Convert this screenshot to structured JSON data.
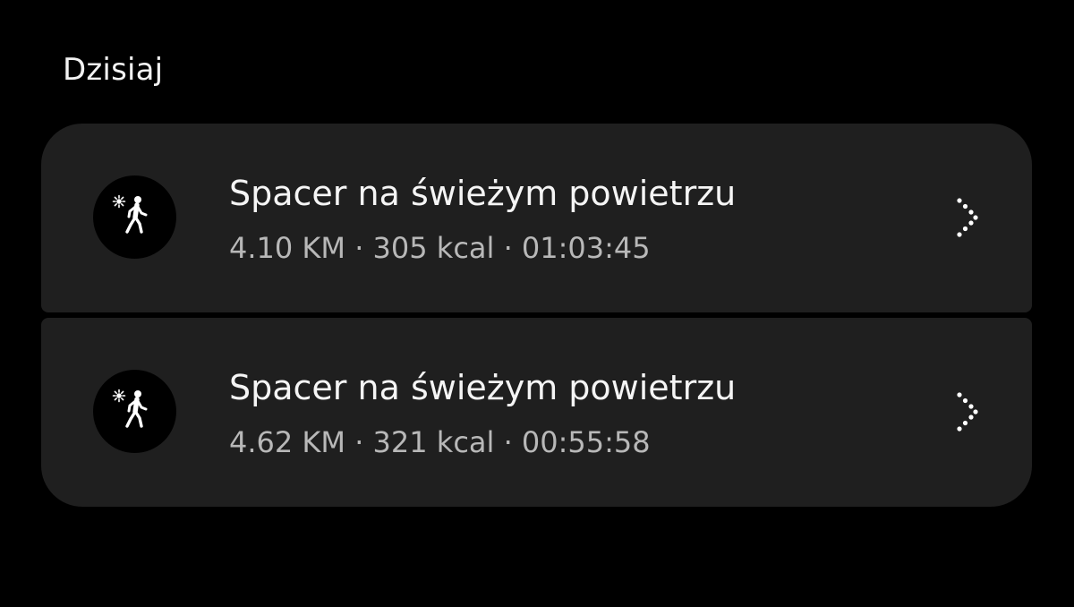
{
  "section": {
    "title": "Dzisiaj"
  },
  "items": [
    {
      "title": "Spacer na świeżym powietrzu",
      "details": "4.10 KM · 305 kcal · 01:03:45",
      "icon": "outdoor-walk-icon"
    },
    {
      "title": "Spacer na świeżym powietrzu",
      "details": "4.62 KM · 321 kcal · 00:55:58",
      "icon": "outdoor-walk-icon"
    }
  ],
  "colors": {
    "background": "#000000",
    "card": "#1f1f1f",
    "title_text": "#f5f5f5",
    "secondary_text": "#b8b8b8"
  }
}
